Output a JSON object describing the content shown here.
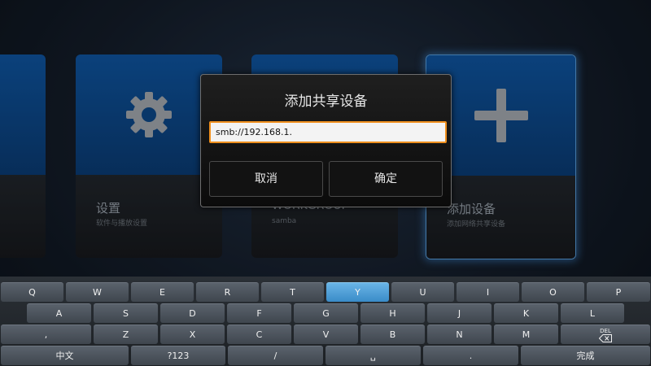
{
  "tiles": [
    {
      "title": "",
      "subtitle": ""
    },
    {
      "title": "设置",
      "subtitle": "软件与播放设置",
      "icon": "gear-icon"
    },
    {
      "title": "WORKGROUP",
      "subtitle": "samba",
      "icon": "folder-icon"
    },
    {
      "title": "添加设备",
      "subtitle": "添加网络共享设备",
      "icon": "plus-icon"
    }
  ],
  "dialog": {
    "title": "添加共享设备",
    "input_value": "smb://192.168.1.",
    "cancel_label": "取消",
    "ok_label": "确定"
  },
  "keyboard": {
    "row1": [
      "Q",
      "W",
      "E",
      "R",
      "T",
      "Y",
      "U",
      "I",
      "O",
      "P"
    ],
    "row2": [
      "A",
      "S",
      "D",
      "F",
      "G",
      "H",
      "J",
      "K",
      "L"
    ],
    "row3": [
      ",",
      "Z",
      "X",
      "C",
      "V",
      "B",
      "N",
      "M"
    ],
    "del_label": "DEL",
    "lang_label": "中文",
    "sym_label": "?123",
    "slash_label": "/",
    "space_label": "␣",
    "dot_label": ".",
    "done_label": "完成",
    "active_key": "Y"
  },
  "colors": {
    "tile_blue": "#0f57a5",
    "focus_glow": "#5aa0e0",
    "input_border": "#f0901e",
    "key_active": "#4da1d8"
  }
}
